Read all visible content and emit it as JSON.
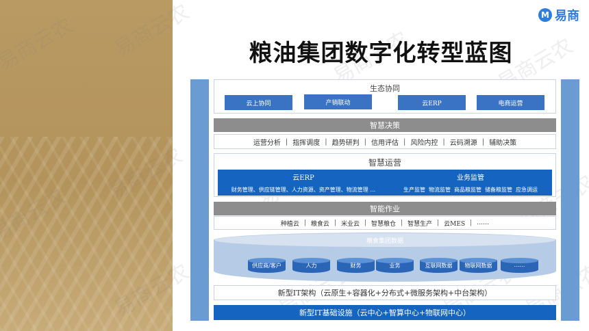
{
  "brand": {
    "logo_mark": "M",
    "logo_text": "易商"
  },
  "watermark": "易商云农",
  "page_title": "粮油集团数字化转型蓝图",
  "ecology": {
    "title": "生态协同",
    "items": [
      "云上协同",
      "产销联动",
      "云ERP",
      "电商运营"
    ]
  },
  "decision": {
    "title": "智慧决策",
    "items": [
      "运营分析",
      "指挥调度",
      "趋势研判",
      "信用评估",
      "风险内控",
      "云码溯源",
      "辅助决策"
    ]
  },
  "operations": {
    "title": "智慧运营",
    "erp_title": "云ERP",
    "erp_items": "财务管理、供应链管理、人力资源、资产管理、物流管理 …",
    "supervision_title": "业务监管",
    "supervision_items": [
      "生产监管",
      "物流监管",
      "商品粮监管",
      "储备粮监管",
      "应急调运"
    ]
  },
  "work": {
    "title": "智能作业",
    "items": [
      "种植云",
      "粮食云",
      "米业云",
      "智慧粮仓",
      "智慧生产",
      "云MES",
      "……"
    ]
  },
  "data_center": {
    "title": "粮食集团数据",
    "items": [
      "供应商/客户",
      "人力",
      "财务",
      "业务",
      "互联网数据",
      "物联网数据",
      "……"
    ]
  },
  "it_architecture": "新型IT架构（云原生+容器化+分布式+微服务架构+中台架构）",
  "it_infrastructure": "新型IT基础设施（云中心+智算中心+物联网中心）"
}
